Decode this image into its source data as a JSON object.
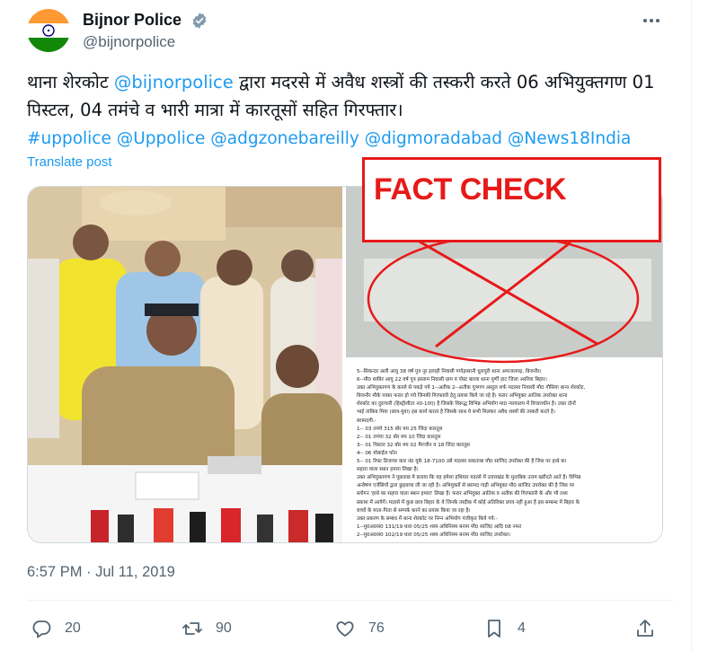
{
  "author": {
    "name": "Bijnor Police",
    "handle": "@bijnorpolice"
  },
  "tweet": {
    "text_part1": "थाना शेरकोट ",
    "mention_self": "@bijnorpolice",
    "text_part2": " द्वारा मदरसे में अवैध शस्त्रों की तस्करी करते 06 अभियुक्तगण 01 पिस्टल, 04 तमंचे व भारी मात्रा में कारतूसों सहित गिरफ्तार।",
    "tags": "#uppolice @Uppolice @adgzonebareilly @digmoradabad @News18India",
    "translate_label": "Translate post"
  },
  "media": {
    "overlay_label": "FACT CHECK",
    "document_lines": [
      "5--सिकन्दर अली आयु 38 वर्ष पुत्र नूर इलाही निवासी गगोड़ासानी धुलपुरी थाना अफजलगढ़, बिजनौर।",
      "6--मौ0 साबिर आयु 22 वर्ष पुत्र इस्लाम निवासी ग्राम व पोस्ट बारवा थाना पुर्णी हाट जिला अररिया बिहार।",
      "उक्त अभियुक्तगण के कब्जे से पकड़े गये 1--अतीक 2--अतीक पुत्रगण अब्दुल शर्फ मदरसा निवासी मौ0 गौसिया थाना शेरकोट,",
      "बिजनौर मौके पाकर फरार हो गये जिनकी गिरफ्तारी हेतु प्रयास किये जा रहे है। फरार अभियुक्त आतिक उपरोक्त थाना",
      "शेरकोट का दुराचारी (हिस्ट्रीशीटर न0-10ए) है जिसके विरूद्ध विभिन्न अभियोग मा0 न्यायालय में विचाराधीन है। उक्त दोनों",
      "भाई ताकिब मिया (छात्र-युवा) इस कार्य करता है जिसके साथ ये सभी मिलकर अवैध शस्त्रों की तस्करी करते है।",
      "बरामदगी:-",
      "1-- 03 तमंचे 315 बोर मय 25 जिंदा कारतूस",
      "2-- 01 तमंचा 32 बोर मय 10 जिंदा कारतूस",
      "3-- 01 पिस्टल 32 बोर मय 02 मैगजीन व 18 जिंदा कारतूस",
      "4-- 06 मोबाईल फोन",
      "5-- 01 रिफ्ट डिजायर कार नं0 यूके 18-7100 उसे मदरसा सकताबा मौ0 साजिद उपरोक्त की है जिस पर हाथे का",
      "सहारा वाला स्थान हमारा लिखा है।",
      "उक्त अभियुक्तगण ने पूछताछ मे बताया कि वह हमेशा हथियार मदरसे में उत्तराखंड के मुताबिक उत्तम खरीदते आते है। विभिन्न",
      "अन्वेषण एजेंसियों द्वारा छुड़वाया ली जा रही है। अभियुक्तों से बरामद गाड़ी अभियुक्त मौ0 साजिद उपरोक्त की है जिस पर",
      "स्लोगन 'हाथे का सहारा वाला स्थान हमारा' लिखा है। फरार अभियुक्त आतिक व अतीक की गिरफ्तारी के और भी तथ्य",
      "प्रकाश में आयेगें। मदरसे में कुछ छात्र बिहार के वे जिनके तस्दीक में कोई अतिरिक्त प्रपत्र नहीं हुआ है इस सम्बन्ध में बिहार के",
      "बच्चों के माता-पिता से सम्पर्क करने का प्रयास किया जा रहा है।",
      "उक्त प्रकरण के सम्बंध में थाना शेरकोट पर निम्न अभियोग पंजीकृत किये गये:-",
      "1--मु0अ0सं0 131/19 धारा 05/25 शस्त्र अधिनियम बनाम मौ0 साजिद आदि 08 नफर",
      "2--मु0अ0सं0 102/19 धारा 05/25 शस्त्र अधिनियम बनाम मौ0 साजिद उपरोक्त।"
    ]
  },
  "timestamp": "6:57 PM · Jul 11, 2019",
  "actions": {
    "replies": "20",
    "reposts": "90",
    "likes": "76",
    "bookmarks": "4"
  },
  "colors": {
    "link": "#1d9bf0",
    "fact_check_red": "#e81919",
    "secondary_text": "#536471"
  }
}
